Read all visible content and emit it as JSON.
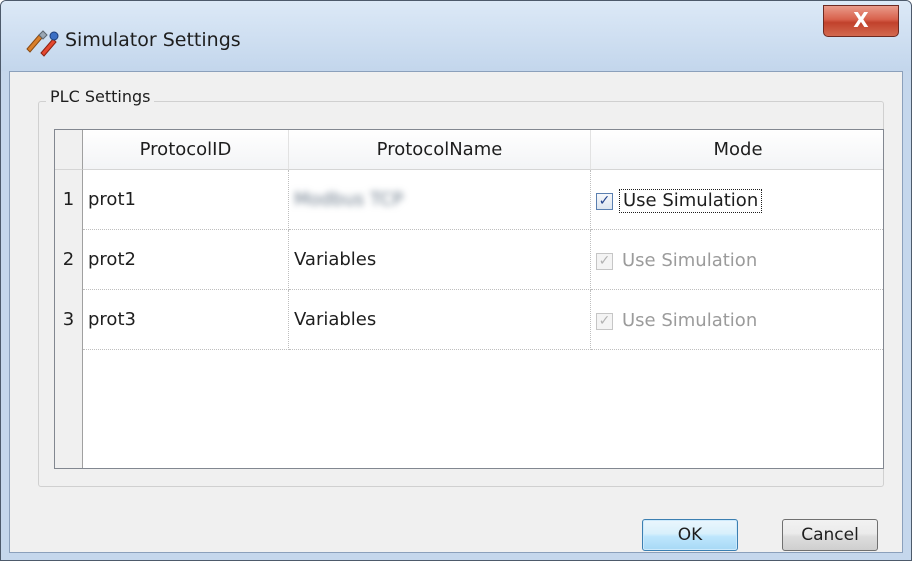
{
  "window": {
    "title": "Simulator Settings",
    "close_label": "X"
  },
  "group": {
    "legend": "PLC Settings"
  },
  "table": {
    "columns": [
      "ProtocolID",
      "ProtocolName",
      "Mode"
    ],
    "rows": [
      {
        "index": "1",
        "protocol_id": "prot1",
        "protocol_name": "Modbus TCP",
        "mode_label": "Use Simulation",
        "checked": true,
        "enabled": true,
        "focused": true
      },
      {
        "index": "2",
        "protocol_id": "prot2",
        "protocol_name": "Variables",
        "mode_label": "Use Simulation",
        "checked": true,
        "enabled": false,
        "focused": false
      },
      {
        "index": "3",
        "protocol_id": "prot3",
        "protocol_name": "Variables",
        "mode_label": "Use Simulation",
        "checked": true,
        "enabled": false,
        "focused": false
      }
    ]
  },
  "buttons": {
    "ok_label": "OK",
    "cancel_label": "Cancel"
  },
  "icons": {
    "app": "simulator-tools-icon",
    "check": "checkmark-icon"
  },
  "colors": {
    "title_bar": "#c5d7ec",
    "close_button": "#c7432e",
    "ok_button_border": "#3c7fb1",
    "checkbox_active": "#23448e"
  }
}
